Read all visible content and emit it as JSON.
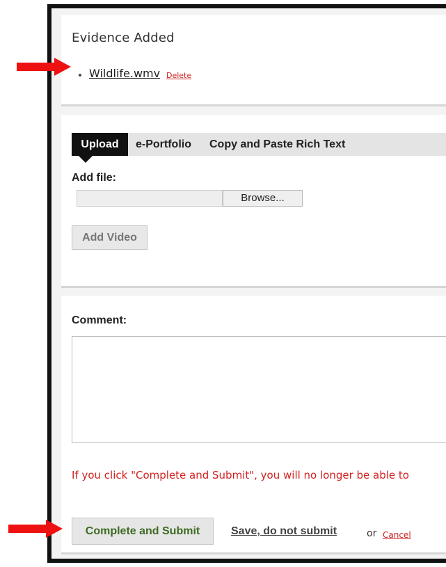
{
  "evidence": {
    "title": "Evidence Added",
    "file_name": "Wildlife.wmv",
    "delete_label": "Delete"
  },
  "upload": {
    "tabs": [
      {
        "label": "Upload",
        "active": true
      },
      {
        "label": "e-Portfolio",
        "active": false
      },
      {
        "label": "Copy and Paste Rich Text",
        "active": false
      }
    ],
    "add_file_label": "Add file:",
    "file_value": "",
    "browse_label": "Browse...",
    "add_video_label": "Add Video"
  },
  "comment": {
    "label": "Comment:",
    "value": ""
  },
  "footer": {
    "warning": "If you click \"Complete and Submit\", you will no longer be able to",
    "submit_label": "Complete and Submit",
    "save_label": "Save, do not submit",
    "or_text": "or",
    "cancel_label": "Cancel"
  },
  "colors": {
    "frame": "#111111",
    "active_tab": "#111111",
    "warning": "#d42020",
    "submit_text": "#3d6b22",
    "annotation_arrow": "#ee1111"
  },
  "icons": {
    "annotation_arrow": "arrow-right-icon"
  }
}
